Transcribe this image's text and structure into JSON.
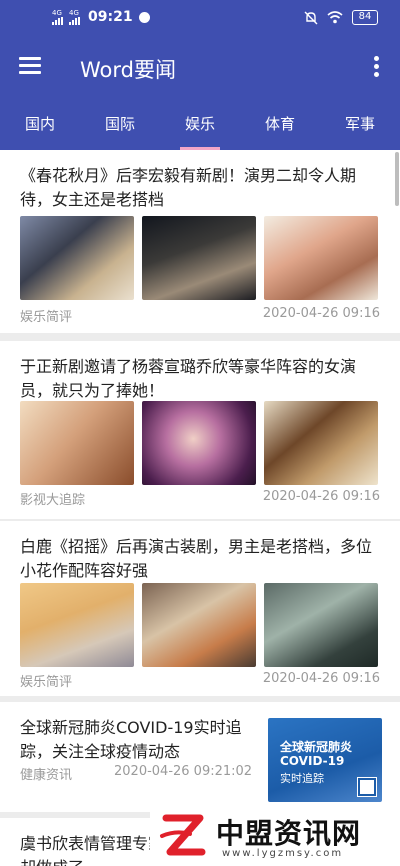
{
  "status_bar": {
    "network_1": "4G",
    "network_2": "4G",
    "time": "09:21",
    "battery": "84"
  },
  "app_bar": {
    "title": "Word要闻"
  },
  "tabs": [
    {
      "label": "国内"
    },
    {
      "label": "国际"
    },
    {
      "label": "娱乐",
      "active": true
    },
    {
      "label": "体育"
    },
    {
      "label": "军事"
    }
  ],
  "articles": [
    {
      "title": "《春花秋月》后李宏毅有新剧！演男二却令人期待，女主还是老搭档",
      "source": "娱乐简评",
      "time": "2020-04-26 09:16"
    },
    {
      "title": "于正新剧邀请了杨蓉宣璐乔欣等豪华阵容的女演员，就只为了捧她！",
      "source": "影视大追踪",
      "time": "2020-04-26 09:16"
    },
    {
      "title": "白鹿《招摇》后再演古装剧，男主是老搭档，多位小花作配阵容好强",
      "source": "娱乐简评",
      "time": "2020-04-26 09:16"
    },
    {
      "title": "全球新冠肺炎COVID-19实时追踪，关注全球疫情动态",
      "source": "健康资讯",
      "time": "2020-04-26 09:21:02",
      "thumb_text": {
        "line1": "全球新冠肺炎",
        "line2": "COVID-19",
        "line3": "实时追踪"
      }
    },
    {
      "title": "虞书欣表情管理专家 像派，却做成了"
    }
  ],
  "watermark": {
    "title": "中盟资讯网",
    "url": "www.lygzmsy.com"
  },
  "colors": {
    "primary": "#3f4fb0",
    "tab_indicator": "#f3a6c7",
    "logo_red": "#e0212b"
  }
}
